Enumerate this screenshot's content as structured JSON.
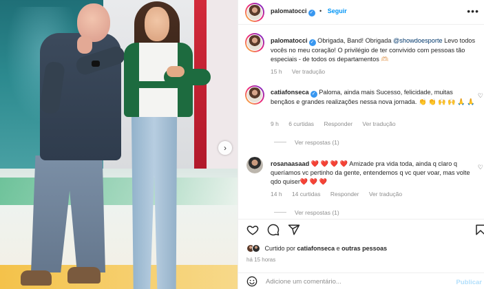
{
  "header": {
    "username": "palomatocci",
    "follow_label": "Seguir",
    "more_icon": "more-horizontal-icon"
  },
  "caption": {
    "username": "palomatocci",
    "text_before": "Obrigada, Band! Obrigada ",
    "mention": "@showdoesporte",
    "text_after": " Levo todos vocês no meu coração! O privilégio de ter convivido com pessoas tão especiais - de todos os departamentos 🫶🏻",
    "time": "15 h",
    "translate_label": "Ver tradução"
  },
  "comments": [
    {
      "username": "catiafonseca",
      "verified": true,
      "text": "Paloma, ainda mais Sucesso, felicidade, muitas bençãos e grandes realizações nessa nova jornada. 👏 👏 🙌 🙌 🙏 🙏",
      "time": "9 h",
      "likes": "6 curtidas",
      "reply_label": "Responder",
      "translate_label": "Ver tradução",
      "replies_label": "Ver respostas (1)"
    },
    {
      "username": "rosanaasaad",
      "verified": false,
      "text": "❤️ ❤️ ❤️ ❤️ Amizade pra vida toda, ainda q claro q queríamos vc pertinho da gente, entendemos q vc quer voar, mas volte qdo quiser❤️ ❤️ ❤️",
      "time": "14 h",
      "likes": "14 curtidas",
      "reply_label": "Responder",
      "translate_label": "Ver tradução",
      "replies_label": "Ver respostas (1)"
    }
  ],
  "actions": {
    "like_icon": "heart-icon",
    "comment_icon": "comment-icon",
    "share_icon": "share-icon",
    "save_icon": "bookmark-icon"
  },
  "likes": {
    "prefix": "Curtido por ",
    "user": "catiafonseca",
    "middle": " e ",
    "others": "outras pessoas"
  },
  "post_time": "há 15 horas",
  "add_comment": {
    "placeholder": "Adicione um comentário...",
    "publish_label": "Publicar",
    "emoji_icon": "emoji-icon"
  },
  "photo": {
    "next_icon": "chevron-right-icon"
  },
  "colors": {
    "link": "#0095f6",
    "muted": "#8e8e8e",
    "verified": "#3897f0"
  }
}
